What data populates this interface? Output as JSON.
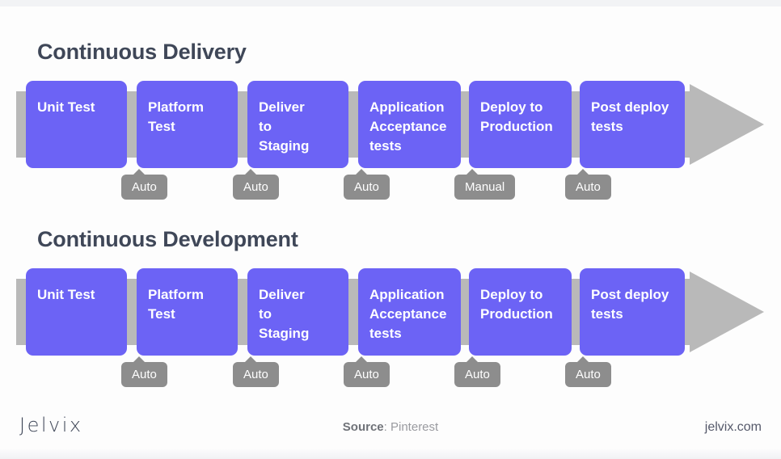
{
  "slide": {
    "background_color": "#fdfdfd",
    "accent_color": "#6c63f5",
    "band_color": "#b9b9b9",
    "tag_color": "#8d8d8d",
    "title_color": "#3f4758"
  },
  "sections": [
    {
      "id": "continuous-delivery",
      "title": "Continuous Delivery",
      "stages": [
        {
          "label": "Unit Test",
          "tag": null
        },
        {
          "label": "Platform\nTest",
          "tag": "Auto"
        },
        {
          "label": "Deliver\nto\nStaging",
          "tag": "Auto"
        },
        {
          "label": "Application\nAcceptance\ntests",
          "tag": "Auto"
        },
        {
          "label": "Deploy to\nProduction",
          "tag": "Manual"
        },
        {
          "label": "Post deploy\ntests",
          "tag": "Auto"
        }
      ]
    },
    {
      "id": "continuous-development",
      "title": "Continuous Development",
      "stages": [
        {
          "label": "Unit Test",
          "tag": null
        },
        {
          "label": "Platform\nTest",
          "tag": "Auto"
        },
        {
          "label": "Deliver\nto\nStaging",
          "tag": "Auto"
        },
        {
          "label": "Application\nAcceptance\ntests",
          "tag": "Auto"
        },
        {
          "label": "Deploy to\nProduction",
          "tag": "Auto"
        },
        {
          "label": "Post deploy\ntests",
          "tag": "Auto"
        }
      ]
    }
  ],
  "footer": {
    "logo": "Jelvix",
    "source_label": "Source",
    "source_separator": ": ",
    "source_value": "Pinterest",
    "site_url": "jelvix.com"
  }
}
